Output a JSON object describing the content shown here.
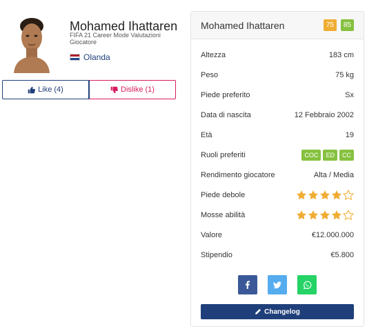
{
  "player": {
    "name": "Mohamed Ihattaren",
    "subtitle": "FIFA 21 Career Mode Valutazioni Giocatore",
    "nation": "Olanda",
    "flag_colors": [
      "#ae1c28",
      "#ffffff",
      "#21468b"
    ]
  },
  "votes": {
    "like_label": "Like (4)",
    "dislike_label": "Dislike (1)"
  },
  "card": {
    "title": "Mohamed Ihattaren",
    "overall": "75",
    "potential": "85",
    "rows": {
      "height": {
        "label": "Altezza",
        "value": "183 cm"
      },
      "weight": {
        "label": "Peso",
        "value": "75 kg"
      },
      "foot": {
        "label": "Piede preferito",
        "value": "Sx"
      },
      "birth": {
        "label": "Data di nascita",
        "value": "12 Febbraio 2002"
      },
      "age": {
        "label": "Età",
        "value": "19"
      },
      "positions": {
        "label": "Ruoli preferiti",
        "tags": [
          "COC",
          "ED",
          "CC"
        ]
      },
      "workrate": {
        "label": "Rendimento giocatore",
        "value": "Alta / Media"
      },
      "weak_foot": {
        "label": "Piede debole",
        "stars": 4,
        "max": 5
      },
      "skills": {
        "label": "Mosse abilità",
        "stars": 4,
        "max": 5
      },
      "value": {
        "label": "Valore",
        "value": "€12.000.000"
      },
      "wage": {
        "label": "Stipendio",
        "value": "€5.800"
      }
    },
    "changelog_label": "Changelog"
  },
  "colors": {
    "accent": "#1f3f7a",
    "dislike": "#d81b60",
    "ovr_badge": "#f0ad34",
    "green_badge": "#86c13f",
    "star": "#f0ad34"
  },
  "icons": [
    "thumbs-up-icon",
    "thumbs-down-icon",
    "facebook-icon",
    "twitter-icon",
    "whatsapp-icon",
    "pencil-icon",
    "star-icon"
  ]
}
